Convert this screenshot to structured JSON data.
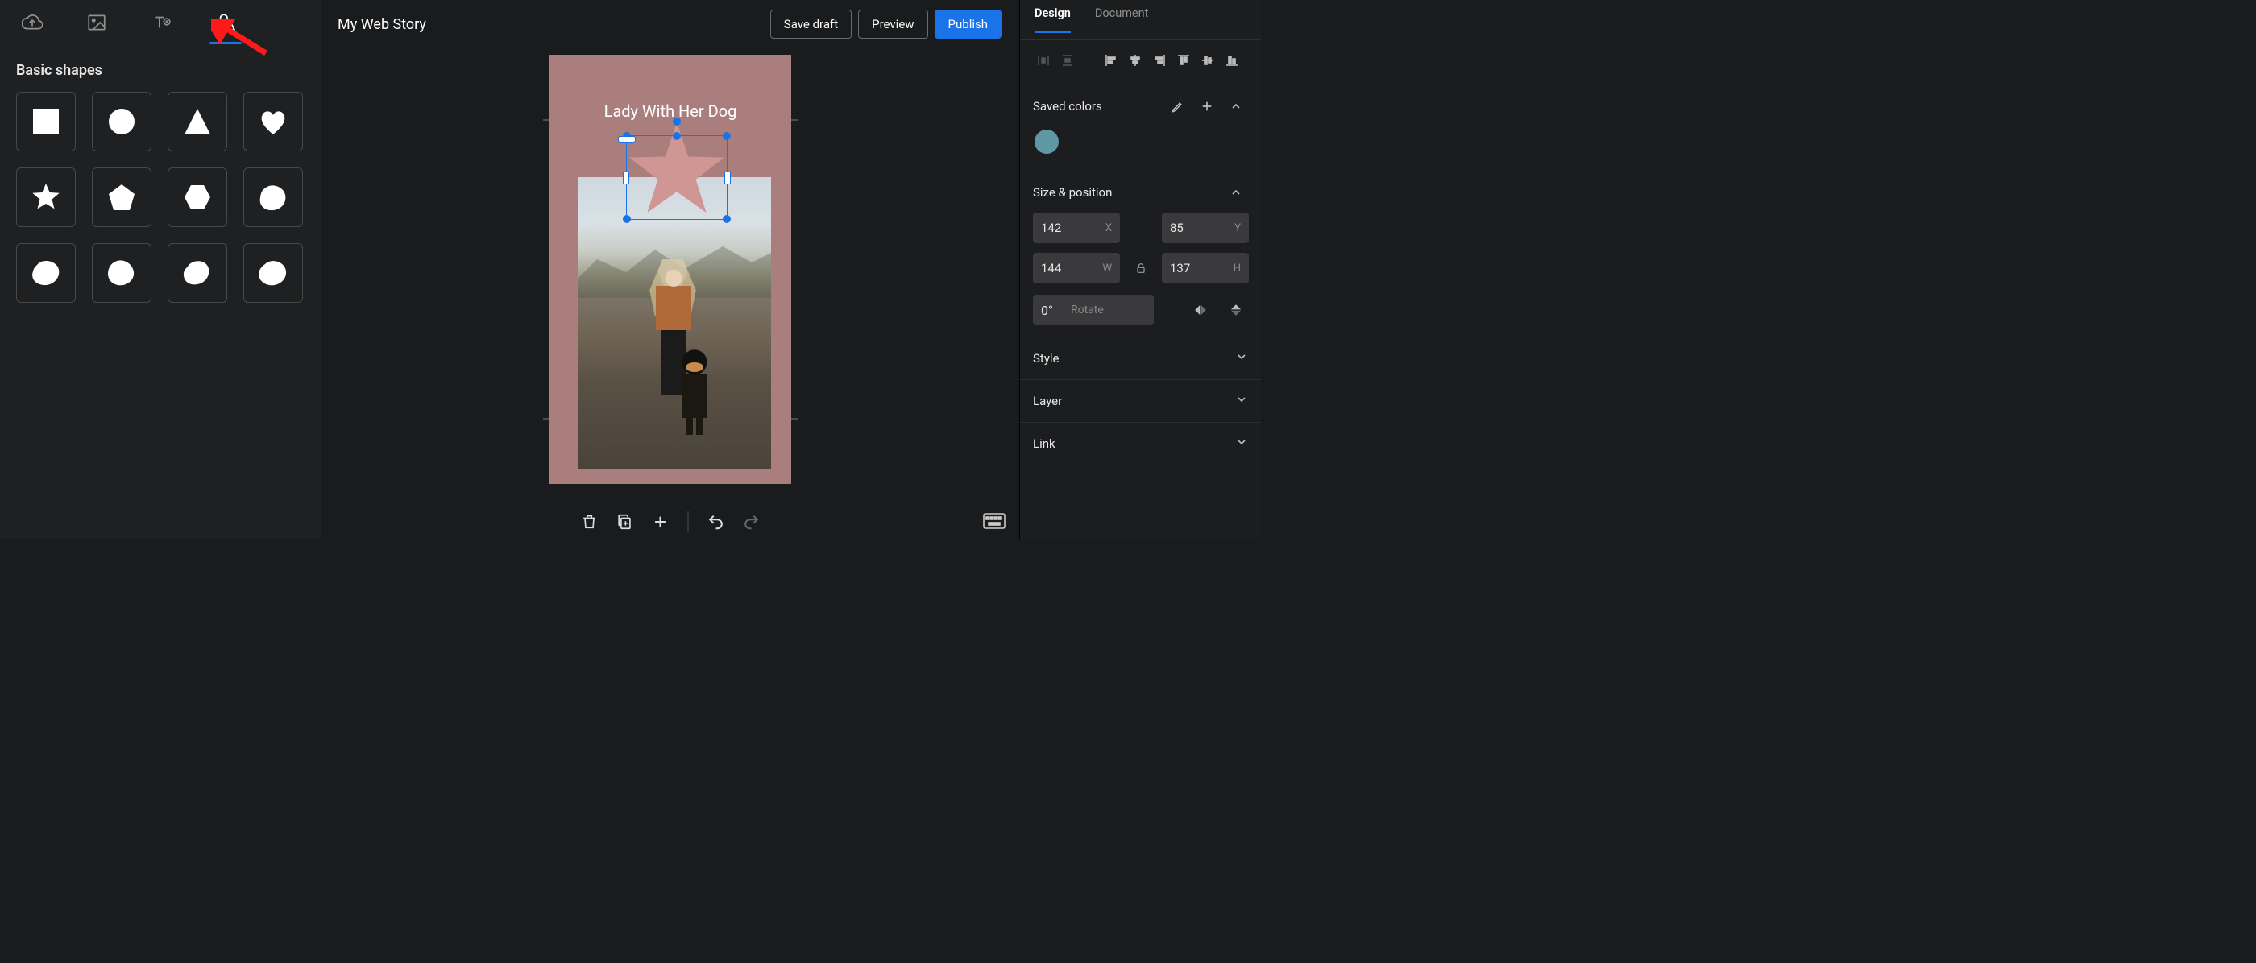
{
  "leftTabs": [
    "upload",
    "media",
    "text",
    "shapes"
  ],
  "shapesPanel": {
    "title": "Basic shapes",
    "shapes": [
      "square",
      "circle",
      "triangle",
      "heart",
      "star",
      "pentagon",
      "hexagon",
      "blob1",
      "blob2",
      "blob3",
      "blob4",
      "blob5"
    ]
  },
  "story": {
    "title": "My Web Story",
    "caption": "Lady With Her Dog"
  },
  "buttons": {
    "saveDraft": "Save draft",
    "preview": "Preview",
    "publish": "Publish"
  },
  "rightPanel": {
    "tabs": {
      "design": "Design",
      "document": "Document"
    },
    "savedColors": {
      "title": "Saved colors",
      "swatches": [
        "#5f97a3"
      ]
    },
    "sizePosition": {
      "title": "Size & position",
      "x": "142",
      "xLabel": "X",
      "y": "85",
      "yLabel": "Y",
      "w": "144",
      "wLabel": "W",
      "h": "137",
      "hLabel": "H",
      "rotate": "0°",
      "rotateLabel": "Rotate"
    },
    "styleTitle": "Style",
    "layerTitle": "Layer",
    "linkTitle": "Link"
  }
}
